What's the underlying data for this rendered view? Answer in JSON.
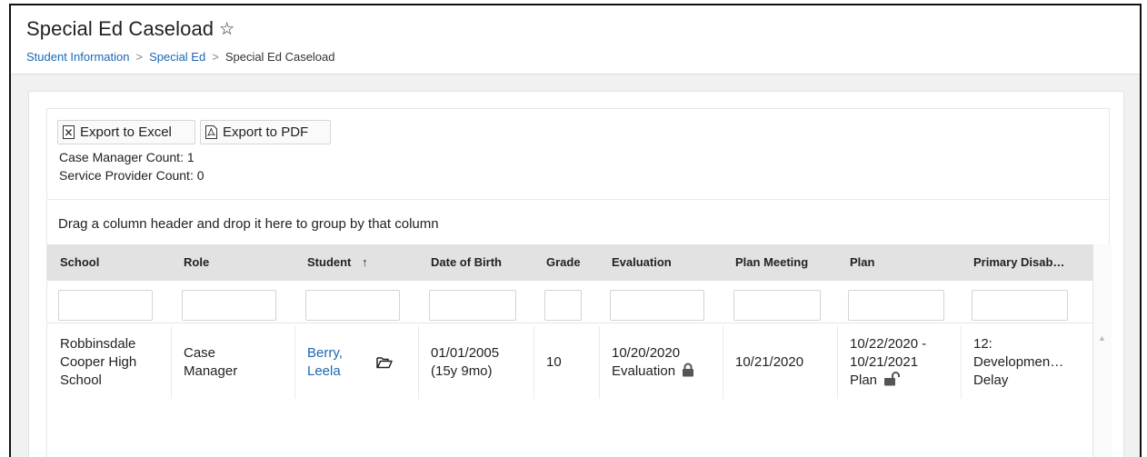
{
  "header": {
    "title": "Special Ed Caseload",
    "breadcrumb": [
      "Student Information",
      "Special Ed",
      "Special Ed Caseload"
    ]
  },
  "toolbar": {
    "export_excel": "Export to Excel",
    "export_pdf": "Export to PDF"
  },
  "counts": {
    "case_manager": "Case Manager Count: 1",
    "service_provider": "Service Provider Count: 0"
  },
  "group_hint": "Drag a column header and drop it here to group by that column",
  "table": {
    "columns": [
      "School",
      "Role",
      "Student",
      "Date of Birth",
      "Grade",
      "Evaluation",
      "Plan Meeting",
      "Plan",
      "Primary Disab…"
    ],
    "sort_indicator": "↑",
    "rows": [
      {
        "school": [
          "Robbinsdale",
          "Cooper High",
          "School"
        ],
        "role": [
          "Case",
          "Manager"
        ],
        "student": [
          "Berry,",
          "Leela"
        ],
        "dob": [
          "01/01/2005",
          "(15y 9mo)"
        ],
        "grade": "10",
        "evaluation": [
          "10/20/2020",
          "Evaluation"
        ],
        "plan_meeting": "10/21/2020",
        "plan": [
          "10/22/2020 -",
          "10/21/2021",
          "Plan"
        ],
        "primary_disability": [
          "12:",
          "Developmen…",
          "Delay"
        ]
      }
    ]
  },
  "colors": {
    "link": "#1b67b3",
    "header_bg": "#e2e2e2"
  }
}
